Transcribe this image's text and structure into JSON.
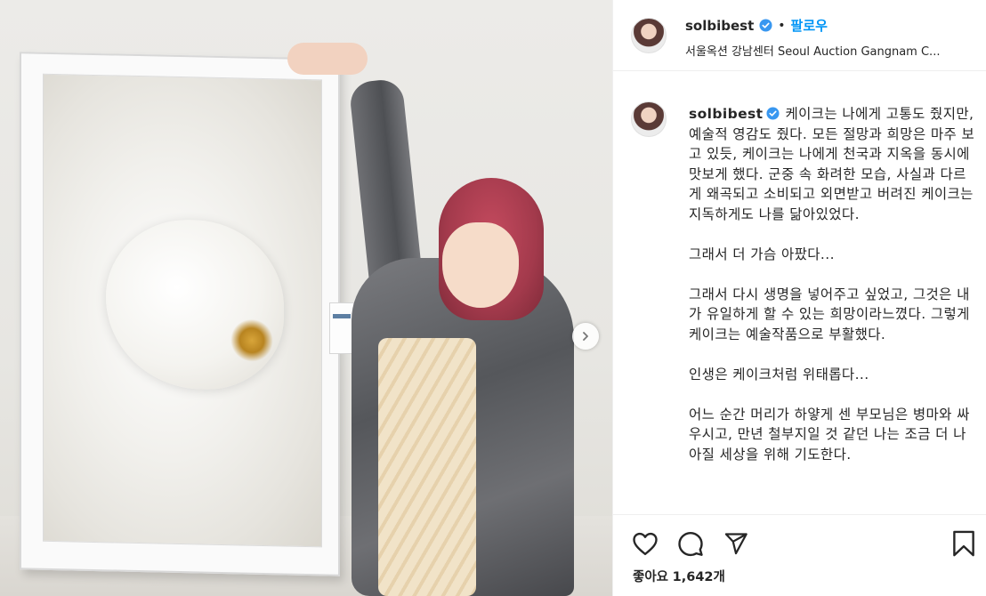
{
  "header": {
    "username": "solbibest",
    "separator": "•",
    "follow_label": "팔로우",
    "location": "서울옥션 강남센터 Seoul Auction Gangnam C..."
  },
  "caption": {
    "username": "solbibest",
    "first_line": "케이크는 나에게 고통도 줬지만, 예술적 영감도 줬다. 모든 절망과 희망은 마주 보고 있듯, 케이크는 나에게 천국과 지옥을 동시에 맛보게 했다. 군중 속 화려한 모습, 사실과 다르게 왜곡되고 소비되고 외면받고 버려진 케이크는 지독하게도 나를 닮아있었다.",
    "p2": "그래서 더 가슴 아팠다...",
    "p3": "그래서 다시 생명을 넣어주고 싶었고, 그것은 내가 유일하게 할 수 있는 희망이라느꼈다. 그렇게 케이크는 예술작품으로 부활했다.",
    "p4": "인생은 케이크처럼 위태롭다...",
    "p5": "어느 순간 머리가 하얗게 센 부모님은 병마와 싸우시고, 만년 철부지일 것 같던 나는 조금 더 나아질 세상을 위해 기도한다."
  },
  "likes": {
    "label": "좋아요",
    "count": "1,642개"
  },
  "icons": {
    "like": "heart-icon",
    "comment": "comment-icon",
    "share": "paper-plane-icon",
    "save": "bookmark-icon",
    "next": "chevron-right-icon",
    "verified": "verified-badge-icon"
  },
  "colors": {
    "follow": "#0095f6",
    "verified": "#3897f0",
    "text": "#262626",
    "border": "#efefef"
  }
}
